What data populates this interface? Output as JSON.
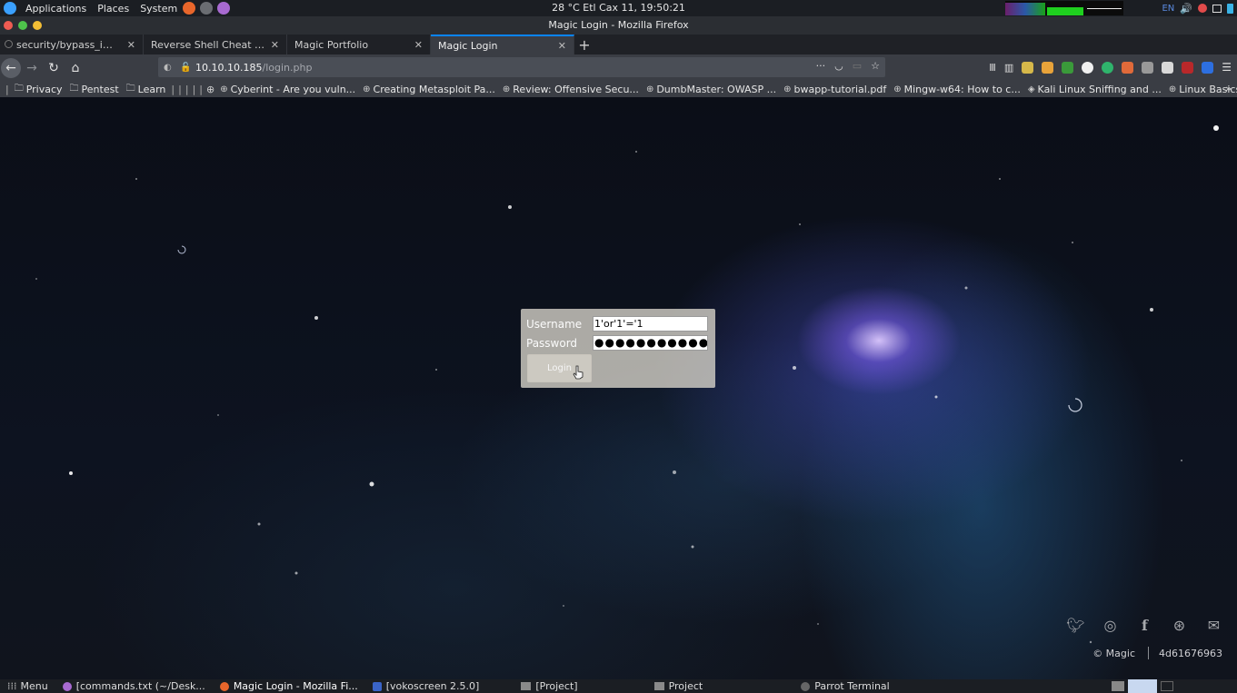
{
  "system_panel": {
    "menus": [
      "Applications",
      "Places",
      "System"
    ],
    "center_text": "28 °C   Etl Cax 11, 19:50:21",
    "lang": "EN"
  },
  "window": {
    "title": "Magic Login - Mozilla Firefox"
  },
  "tabs": [
    {
      "label": "security/bypass_image_u",
      "active": false
    },
    {
      "label": "Reverse Shell Cheat Sheet | ",
      "active": false
    },
    {
      "label": "Magic Portfolio",
      "active": false
    },
    {
      "label": "Magic Login",
      "active": true
    }
  ],
  "url": {
    "host": "10.10.10.185",
    "path": "/login.php",
    "more": "···"
  },
  "bookmarks": [
    {
      "label": "Privacy",
      "icon": "folder-icon"
    },
    {
      "label": "Pentest",
      "icon": "folder-icon"
    },
    {
      "label": "Learn",
      "icon": "folder-icon"
    },
    {
      "label": "Cyberint - Are you vuln...",
      "icon": "globe-icon"
    },
    {
      "label": "Creating Metasploit Pa...",
      "icon": "globe-icon"
    },
    {
      "label": "Review: Offensive Secu...",
      "icon": "globe-icon"
    },
    {
      "label": "DumbMaster: OWASP ...",
      "icon": "globe-icon"
    },
    {
      "label": "bwapp-tutorial.pdf",
      "icon": "globe-icon"
    },
    {
      "label": "Mingw-w64: How to c...",
      "icon": "globe-icon"
    },
    {
      "label": "Kali Linux Sniffing and ...",
      "icon": "kali-icon"
    },
    {
      "label": "Linux Basics « Null Byt...",
      "icon": "globe-icon"
    }
  ],
  "login": {
    "username_label": "Username",
    "password_label": "Password",
    "username_value": "1'or'1'='1",
    "password_value": "●●●●●●●●●●●",
    "button_label": "Login"
  },
  "footer": {
    "copyright": "© Magic",
    "code": "4d61676963",
    "social_icons": [
      "twitter-icon",
      "instagram-icon",
      "facebook-icon",
      "dribbble-icon",
      "mail-icon"
    ]
  },
  "taskbar": {
    "menu": "Menu",
    "items": [
      "[commands.txt (~/Desk...",
      "Magic Login - Mozilla Fi...",
      "[vokoscreen 2.5.0]",
      "[Project]",
      "Project",
      "Parrot Terminal"
    ]
  }
}
